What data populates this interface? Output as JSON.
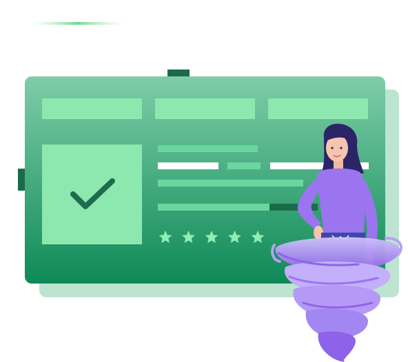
{
  "illustration": {
    "card": {
      "check_icon": "checkmark-icon",
      "rating": {
        "value": 5,
        "max": 5,
        "icon": "star-icon"
      },
      "progress": {
        "fill_fraction": 0.7
      }
    },
    "figure": {
      "icon": "woman-figure",
      "effect_icon": "tornado-icon"
    },
    "colors": {
      "card_dark": "#0e8a57",
      "card_light": "#7fcda8",
      "card_shadow": "#a7dbc2",
      "panel": "#8ce8ae",
      "accent_dark": "#1b6b4a",
      "check": "#1f6b4e",
      "star": "#8ef0b0",
      "figure_purple": "#9b74f0",
      "tornado": "#b8a0f6"
    }
  }
}
